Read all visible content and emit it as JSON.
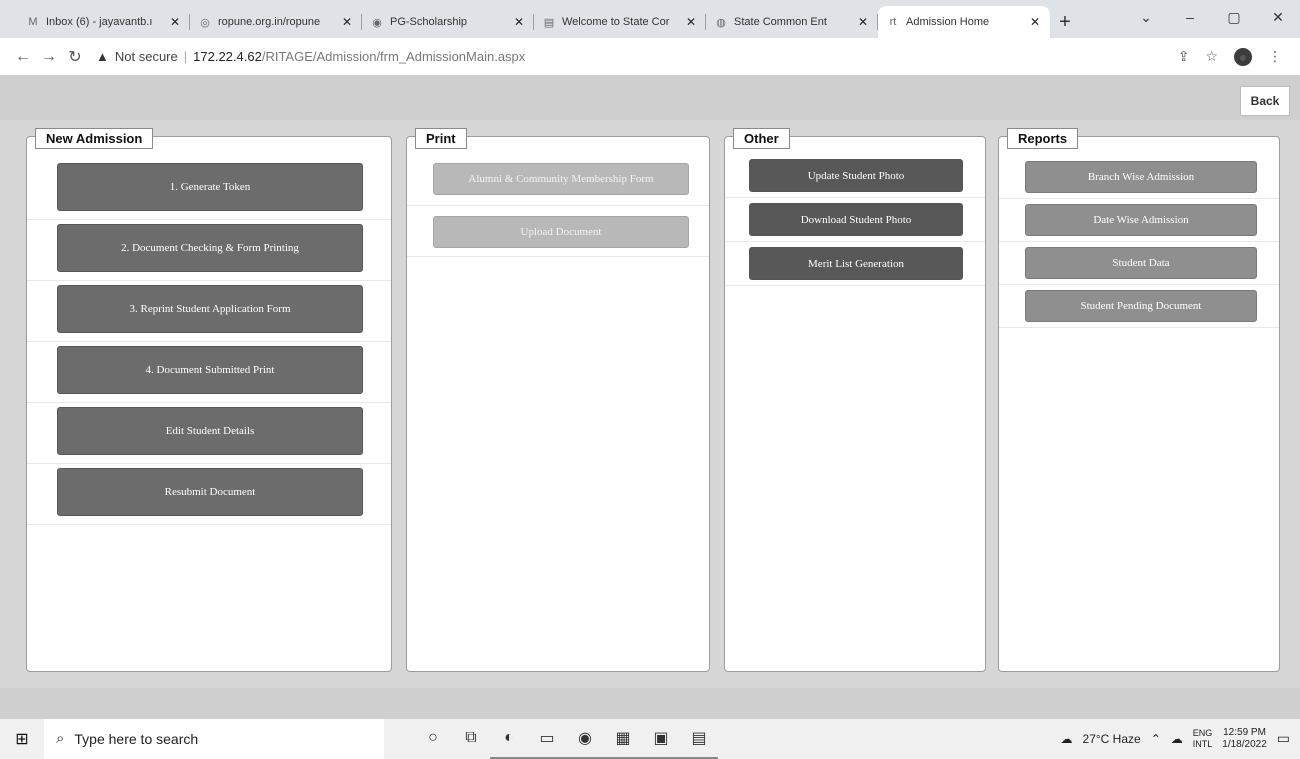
{
  "browser": {
    "tabs": [
      {
        "icon": "gmail-icon",
        "glyph": "M",
        "title": "Inbox (6) - jayavantb.ı"
      },
      {
        "icon": "globe-icon",
        "glyph": "◎",
        "title": "ropune.org.in/ropune"
      },
      {
        "icon": "scholarship-icon",
        "glyph": "◉",
        "title": "PG-Scholarship"
      },
      {
        "icon": "page-icon",
        "glyph": "▤",
        "title": "Welcome to State Cor"
      },
      {
        "icon": "cet-icon",
        "glyph": "◍",
        "title": "State Common Ent"
      },
      {
        "icon": "ritage-icon",
        "glyph": "rt",
        "title": "Admission Home"
      }
    ],
    "active_tab_index": 5,
    "new_tab_glyph": "+",
    "window_controls": [
      "⌄",
      "–",
      "▢",
      "✕"
    ],
    "security_label": "Not secure",
    "url_host": "172.22.4.62",
    "url_path": "/RITAGE/Admission/frm_AdmissionMain.aspx"
  },
  "page": {
    "back_label": "Back",
    "panels": {
      "new_admission": {
        "title": "New Admission",
        "buttons": [
          "1. Generate Token",
          "2. Document Checking & Form Printing",
          "3. Reprint Student Application Form",
          "4. Document Submitted Print",
          "Edit Student Details",
          "Resubmit Document"
        ]
      },
      "print": {
        "title": "Print",
        "buttons": [
          "Alumni & Community Membership Form",
          "Upload Document"
        ]
      },
      "other": {
        "title": "Other",
        "buttons": [
          "Update Student Photo",
          "Download Student Photo",
          "Merit List Generation"
        ]
      },
      "reports": {
        "title": "Reports",
        "buttons": [
          "Branch Wise Admission",
          "Date Wise Admission",
          "Student Data",
          "Student Pending Document"
        ]
      }
    }
  },
  "taskbar": {
    "search_placeholder": "Type here to search",
    "weather": "27°C  Haze",
    "lang_top": "ENG",
    "lang_bottom": "INTL",
    "time": "12:59 PM",
    "date": "1/18/2022"
  },
  "colors": {
    "primary_button": "#6c6c6c",
    "other_button": "#585858",
    "print_button": "#b8b8b8",
    "report_button": "#8f8f8f"
  }
}
